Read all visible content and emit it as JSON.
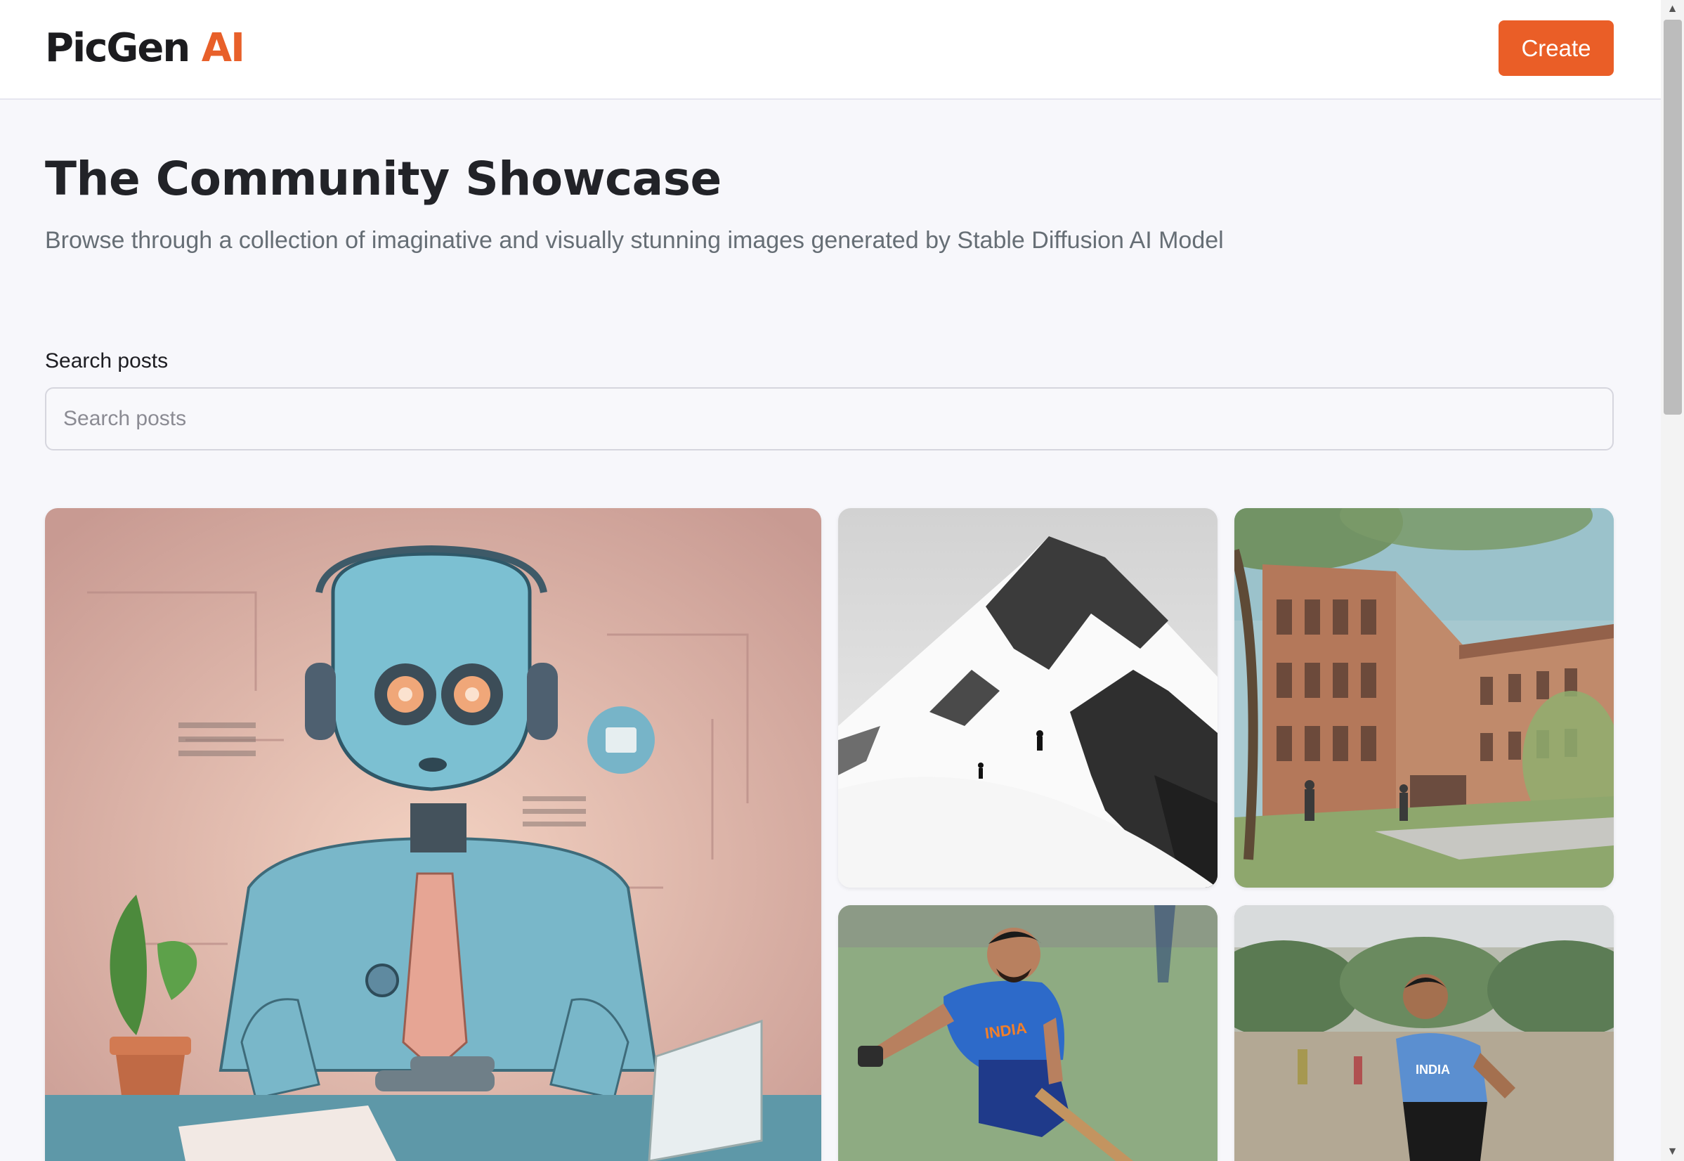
{
  "header": {
    "logo_main": "PicGen",
    "logo_accent": "AI",
    "create_label": "Create"
  },
  "main": {
    "title": "The Community Showcase",
    "subtitle": "Browse through a collection of imaginative and visually stunning images generated by Stable Diffusion AI Model"
  },
  "search": {
    "label": "Search posts",
    "placeholder": "Search posts",
    "value": ""
  },
  "gallery": {
    "posts": [
      {
        "subject": "robot-with-headphones"
      },
      {
        "subject": "snowy-mountain-climbers"
      },
      {
        "subject": "brick-building-sketch"
      },
      {
        "subject": "cricket-batsman"
      },
      {
        "subject": "cricket-player-fielding"
      }
    ]
  },
  "colors": {
    "accent": "#ea5e27",
    "background": "#f7f7fb",
    "text": "#222328",
    "muted": "#666e75"
  },
  "icons": {
    "scroll_up": "▲",
    "scroll_down": "▼"
  }
}
